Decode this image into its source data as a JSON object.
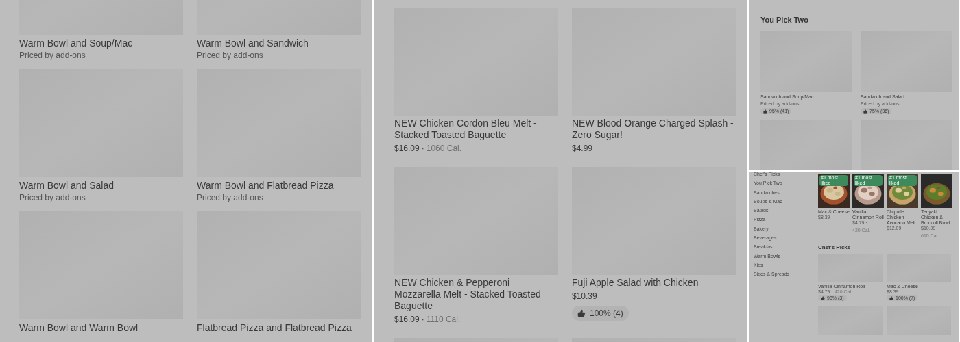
{
  "left_grid": {
    "items": [
      {
        "title": "Warm Bowl and Soup/Mac",
        "subtitle": "Priced by add-ons"
      },
      {
        "title": "Warm Bowl and Sandwich",
        "subtitle": "Priced by add-ons"
      },
      {
        "title": "Warm Bowl and Salad",
        "subtitle": "Priced by add-ons"
      },
      {
        "title": "Warm Bowl and Flatbread Pizza",
        "subtitle": "Priced by add-ons"
      },
      {
        "title": "Warm Bowl and Warm Bowl"
      },
      {
        "title": "Flatbread Pizza and Flatbread Pizza"
      }
    ]
  },
  "middle_grid": {
    "items": [
      {
        "title": "NEW Chicken Cordon Bleu Melt - Stacked Toasted Baguette",
        "price": "$16.09",
        "separator": "·",
        "calories": "1060 Cal."
      },
      {
        "title": "NEW Blood Orange Charged Splash - Zero Sugar!",
        "price": "$4.99"
      },
      {
        "title": "NEW Chicken & Pepperoni Mozzarella Melt - Stacked Toasted Baguette",
        "price": "$16.09",
        "separator": "·",
        "calories": "1110 Cal."
      },
      {
        "title": "Fuji Apple Salad with Chicken",
        "price": "$10.39",
        "rating": "100% (4)"
      }
    ]
  },
  "pick_two": {
    "heading": "You Pick Two",
    "items": [
      {
        "title": "Sandwich and Soup/Mac",
        "subtitle": "Priced by add-ons",
        "rating": "95% (41)"
      },
      {
        "title": "Sandwich and Salad",
        "subtitle": "Priced by add-ons",
        "rating": "75% (36)"
      }
    ]
  },
  "category_page": {
    "sidebar": {
      "items": [
        "Chef's Picks",
        "You Pick Two",
        "Sandwiches",
        "Soups & Mac",
        "Salads",
        "Pizza",
        "Bakery",
        "Beverages",
        "Breakfast",
        "Warm Bowls",
        "Kids",
        "Sides & Spreads"
      ]
    },
    "featured": [
      {
        "badge": "#1 most liked",
        "title": "Mac & Cheese",
        "price": "$8.39"
      },
      {
        "badge": "#1 most liked",
        "title": "Vanilla Cinnamon Roll",
        "price": "$4.79",
        "separator": "·",
        "calories": "420 Cal."
      },
      {
        "badge": "#1 most liked",
        "title": "Chipotle Chicken Avocado Melt",
        "price": "$12.09"
      },
      {
        "title": "Teriyaki Chicken & Broccoli Bowl",
        "price": "$10.09",
        "separator": "·",
        "calories": "610 Cal."
      }
    ],
    "section": {
      "heading": "Chef's Picks",
      "items": [
        {
          "title": "Vanilla Cinnamon Roll",
          "price": "$4.79",
          "separator": "·",
          "calories": "420 Cal.",
          "rating": "98% (3)"
        },
        {
          "title": "Mac & Cheese",
          "price": "$8.39",
          "rating": "100% (7)"
        }
      ]
    }
  }
}
